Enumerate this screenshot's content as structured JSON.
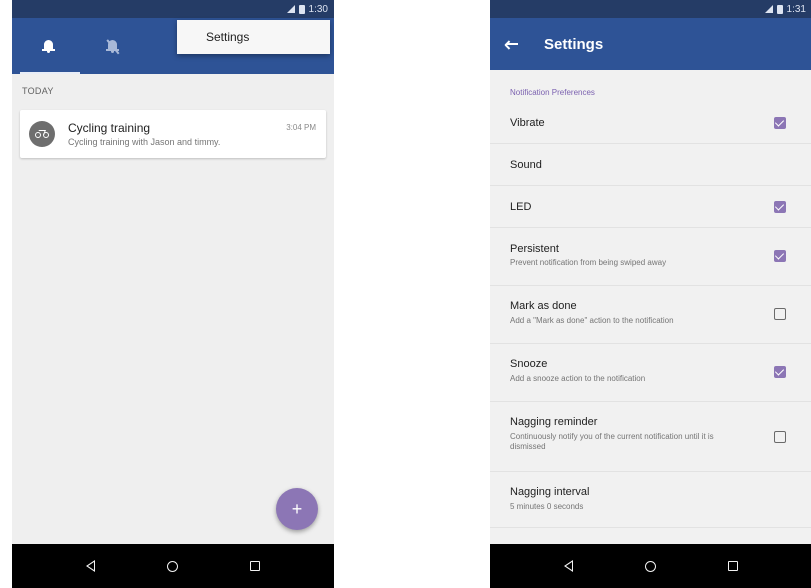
{
  "left_screen": {
    "status_time": "1:30",
    "tabs": [
      {
        "icon": "bell-icon",
        "selected": true
      },
      {
        "icon": "bell-off-icon",
        "selected": false
      }
    ],
    "overflow_menu": {
      "items": [
        "Settings"
      ]
    },
    "section_label": "TODAY",
    "notification": {
      "icon": "bicycle-icon",
      "title": "Cycling training",
      "body": "Cycling training with Jason and timmy.",
      "time": "3:04 PM"
    },
    "fab_label": "+"
  },
  "right_screen": {
    "status_time": "1:31",
    "title": "Settings",
    "category": "Notification Preferences",
    "preferences": [
      {
        "title": "Vibrate",
        "summary": "",
        "checked": true
      },
      {
        "title": "Sound",
        "summary": ""
      },
      {
        "title": "LED",
        "summary": "",
        "checked": true
      },
      {
        "title": "Persistent",
        "summary": "Prevent notification from being swiped away",
        "checked": true
      },
      {
        "title": "Mark as done",
        "summary": "Add a \"Mark as done\" action to the notification",
        "checked": false
      },
      {
        "title": "Snooze",
        "summary": "Add a snooze action to the notification",
        "checked": true
      },
      {
        "title": "Nagging reminder",
        "summary": "Continuously notify you of the current notification until it is dismissed",
        "checked": false
      },
      {
        "title": "Nagging interval",
        "summary": "5 minutes 0 seconds"
      }
    ]
  },
  "colors": {
    "status_bar": "#253c66",
    "app_bar": "#2e5396",
    "accent": "#8c76b5",
    "category_text": "#7c62b0",
    "background": "#efefef"
  }
}
